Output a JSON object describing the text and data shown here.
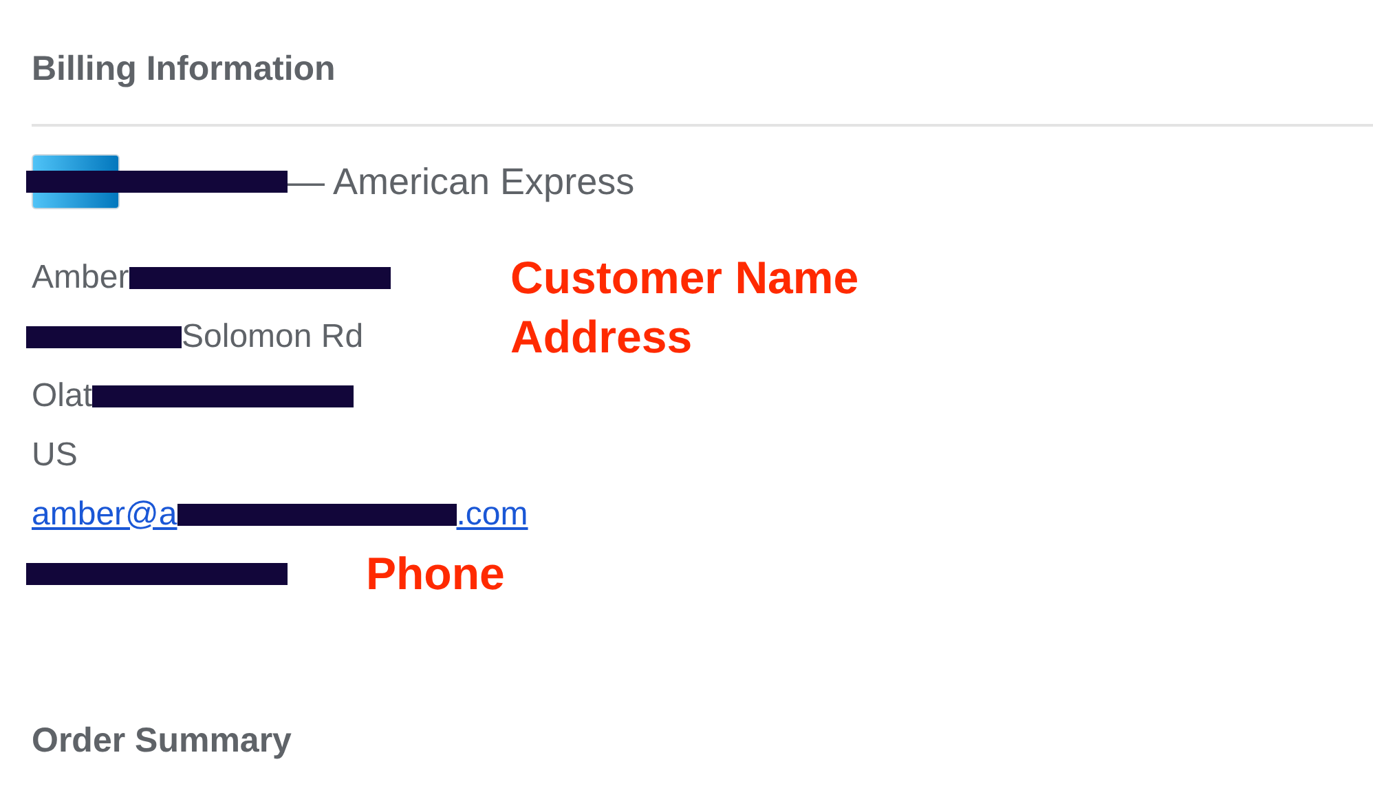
{
  "billing": {
    "title": "Billing Information",
    "card": {
      "segments": [
        {
          "kind": "redacted"
        },
        {
          "kind": "text",
          "text": "— American Express"
        }
      ]
    },
    "lines": [
      {
        "kind": "text",
        "segments": [
          {
            "kind": "text",
            "text": "Amber"
          },
          {
            "kind": "redacted"
          }
        ],
        "annotation": "Customer Name"
      },
      {
        "kind": "text",
        "segments": [
          {
            "kind": "redacted"
          },
          {
            "kind": "text",
            "text": "Solomon Rd"
          }
        ],
        "annotation": "Address"
      },
      {
        "kind": "text",
        "segments": [
          {
            "kind": "text",
            "text": "Olat"
          },
          {
            "kind": "redacted"
          }
        ]
      },
      {
        "kind": "text",
        "segments": [
          {
            "kind": "text",
            "text": "US"
          }
        ]
      },
      {
        "kind": "link",
        "segments": [
          {
            "kind": "text",
            "text": "amber@a"
          },
          {
            "kind": "redacted"
          },
          {
            "kind": "text",
            "text": ".com"
          }
        ]
      },
      {
        "kind": "text",
        "segments": [
          {
            "kind": "redacted"
          }
        ],
        "annotation": "Phone"
      }
    ]
  },
  "order_summary": {
    "title": "Order Summary"
  }
}
